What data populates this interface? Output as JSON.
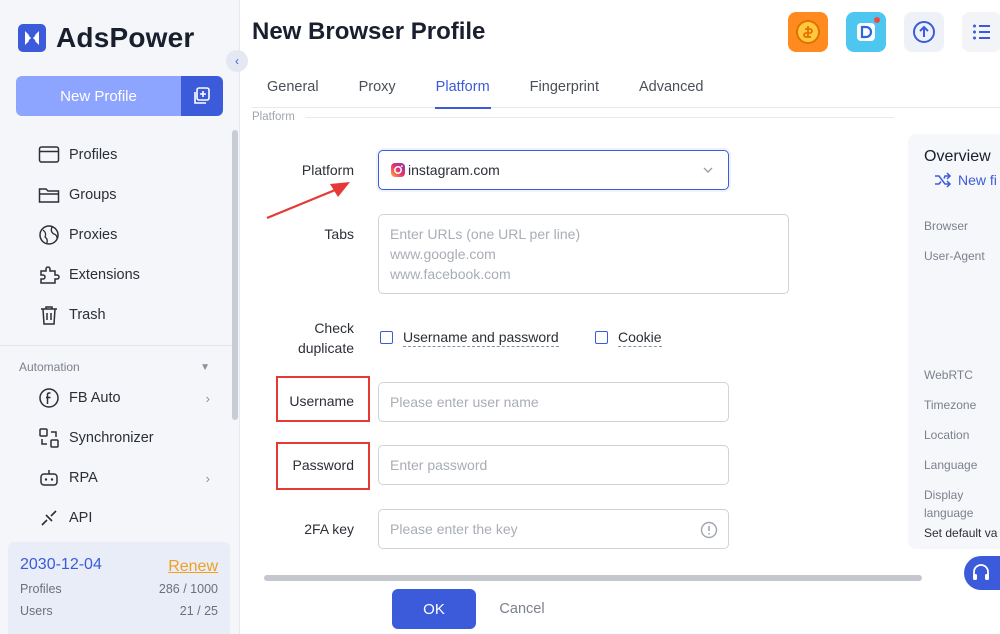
{
  "app": {
    "name": "AdsPower"
  },
  "sidebar": {
    "new_profile_label": "New Profile",
    "nav": [
      {
        "label": "Profiles",
        "icon": "profiles-icon"
      },
      {
        "label": "Groups",
        "icon": "folder-icon"
      },
      {
        "label": "Proxies",
        "icon": "globe-icon"
      },
      {
        "label": "Extensions",
        "icon": "puzzle-icon"
      },
      {
        "label": "Trash",
        "icon": "trash-icon"
      }
    ],
    "automation_label": "Automation",
    "automation": [
      {
        "label": "FB Auto",
        "icon": "fb-auto-icon"
      },
      {
        "label": "Synchronizer",
        "icon": "sync-icon"
      },
      {
        "label": "RPA",
        "icon": "robot-icon"
      },
      {
        "label": "API",
        "icon": "api-icon"
      }
    ],
    "account": {
      "expiry": "2030-12-04",
      "renew_label": "Renew",
      "profiles_label": "Profiles",
      "profiles_value": "286 / 1000",
      "users_label": "Users",
      "users_value": "21 / 25"
    }
  },
  "header": {
    "title": "New Browser Profile"
  },
  "tabs": [
    "General",
    "Proxy",
    "Platform",
    "Fingerprint",
    "Advanced"
  ],
  "form": {
    "section_caption": "Platform",
    "platform_label": "Platform",
    "platform_value": "instagram.com",
    "tabs_label": "Tabs",
    "tabs_placeholder_lines": [
      "Enter URLs (one URL per line)",
      "www.google.com",
      "www.facebook.com"
    ],
    "check_duplicate_label_1": "Check",
    "check_duplicate_label_2": "duplicate",
    "check_option_1": "Username and password",
    "check_option_2": "Cookie",
    "username_label": "Username",
    "username_placeholder": "Please enter user name",
    "password_label": "Password",
    "password_placeholder": "Enter password",
    "twofa_label": "2FA key",
    "twofa_placeholder": "Please enter the key"
  },
  "footer": {
    "ok_label": "OK",
    "cancel_label": "Cancel"
  },
  "overview": {
    "title": "Overview",
    "new_fingerprint": "New fi",
    "labels": [
      "Browser",
      "User-Agent",
      "WebRTC",
      "Timezone",
      "Location",
      "Language",
      "Display",
      "language"
    ],
    "footer": "Set default va"
  },
  "colors": {
    "accent": "#3b5bdb",
    "highlight": "#e53935",
    "renew": "#f0a020"
  }
}
